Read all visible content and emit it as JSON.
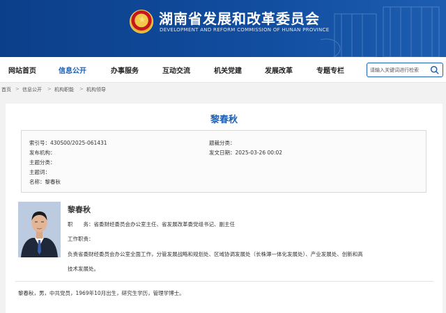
{
  "header": {
    "title": "湖南省发展和改革委员会",
    "subtitle": "DEVELOPMENT AND REFORM COMMISSION OF HUNAN PROVINCE",
    "brand_color": "#114c9e"
  },
  "nav": {
    "items": [
      {
        "label": "网站首页"
      },
      {
        "label": "信息公开",
        "active": true
      },
      {
        "label": "办事服务"
      },
      {
        "label": "互动交流"
      },
      {
        "label": "机关党建"
      },
      {
        "label": "发展改革"
      },
      {
        "label": "专题专栏"
      }
    ],
    "search_placeholder": "请输入关键词进行检索",
    "search_icon": "search-icon"
  },
  "breadcrumb": [
    "首页",
    "信息公开",
    "机构职能",
    "机构领导"
  ],
  "page": {
    "title": "黎春秋"
  },
  "meta": {
    "index_no": "索引号：430S00/2025-061431",
    "theme_category": "题裁分类：",
    "publisher": "发布机构：",
    "publish_date": "发文日期：2025-03-26 00:02",
    "subject_category": "主题分类：",
    "subject_words": "主题词：",
    "name": "名称：黎春秋"
  },
  "profile": {
    "name": "黎春秋",
    "position": "职　　务：省委财经委员会办公室主任、省发展改革委党组书记、副主任",
    "duties_label": "工作职责：",
    "duties_line1": "负责省委财经委员会办公室全面工作，分管发展战略和规划处、区域协调发展处（长株潭一体化发展处）、产业发展处、创新和高",
    "duties_line2": "技术发展处。",
    "bio": "黎春秋，男，中共党员，1969年10月出生，研究生学历，管理学博士。"
  }
}
